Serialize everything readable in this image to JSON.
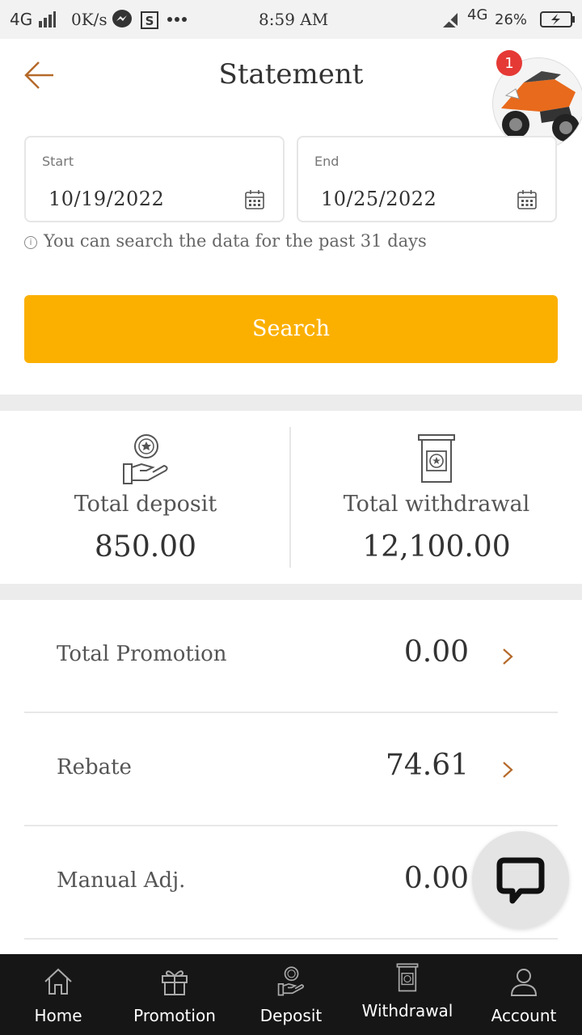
{
  "status_bar": {
    "network": "4G",
    "speed": "0K/s",
    "time": "8:59 AM",
    "network_right": "4G",
    "battery": "26%"
  },
  "header": {
    "title": "Statement",
    "promo_badge": "1"
  },
  "date_range": {
    "start_label": "Start",
    "start_value": "10/19/2022",
    "end_label": "End",
    "end_value": "10/25/2022",
    "hint": "You can search the data for the past 31 days"
  },
  "search_button": "Search",
  "totals": {
    "deposit_label": "Total deposit",
    "deposit_value": "850.00",
    "withdrawal_label": "Total withdrawal",
    "withdrawal_value": "12,100.00"
  },
  "rows": [
    {
      "label": "Total Promotion",
      "amount": "0.00"
    },
    {
      "label": "Rebate",
      "amount": "74.61"
    },
    {
      "label": "Manual Adj.",
      "amount": "0.00"
    }
  ],
  "bottom_nav": [
    {
      "label": "Home",
      "icon": "home-icon"
    },
    {
      "label": "Promotion",
      "icon": "gift-icon"
    },
    {
      "label": "Deposit",
      "icon": "deposit-hand-coin-icon"
    },
    {
      "label": "Withdrawal",
      "icon": "withdrawal-ticket-icon"
    },
    {
      "label": "Account",
      "icon": "user-icon"
    }
  ],
  "colors": {
    "accent": "#fbb000",
    "back_arrow": "#b5692a",
    "nav_bg": "#161616",
    "badge": "#e53935"
  }
}
